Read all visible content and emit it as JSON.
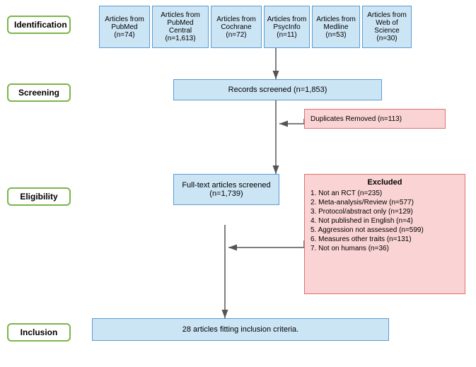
{
  "stages": {
    "identification": "Identification",
    "screening": "Screening",
    "eligibility": "Eligibility",
    "inclusion": "Inclusion"
  },
  "identification_sources": [
    {
      "label": "Articles from PubMed\n(n=74)"
    },
    {
      "label": "Articles from PubMed Central\n(n=1,613)"
    },
    {
      "label": "Articles from Cochrane\n(n=72)"
    },
    {
      "label": "Articles from PsycInfo\n(n=11)"
    },
    {
      "label": "Articles from Medline\n(n=53)"
    },
    {
      "label": "Articles from Web of Science (n=30)"
    }
  ],
  "screening": {
    "records_screened": "Records screened (n=1,853)",
    "duplicates_removed": "Duplicates Removed (n=113)"
  },
  "eligibility": {
    "full_text": "Full-text articles screened\n(n=1,739)",
    "excluded_title": "Excluded",
    "excluded_items": [
      "1. Not an RCT (n=235)",
      "2. Meta-analysis/Review (n=577)",
      "3. Protocol/abstract only (n=129)",
      "4. Not published in English (n=4)",
      "5. Aggression not assessed (n=599)",
      "6. Measures other traits (n=131)",
      "7. Not on humans (n=36)"
    ]
  },
  "inclusion": {
    "result": "28 articles fitting inclusion criteria."
  }
}
